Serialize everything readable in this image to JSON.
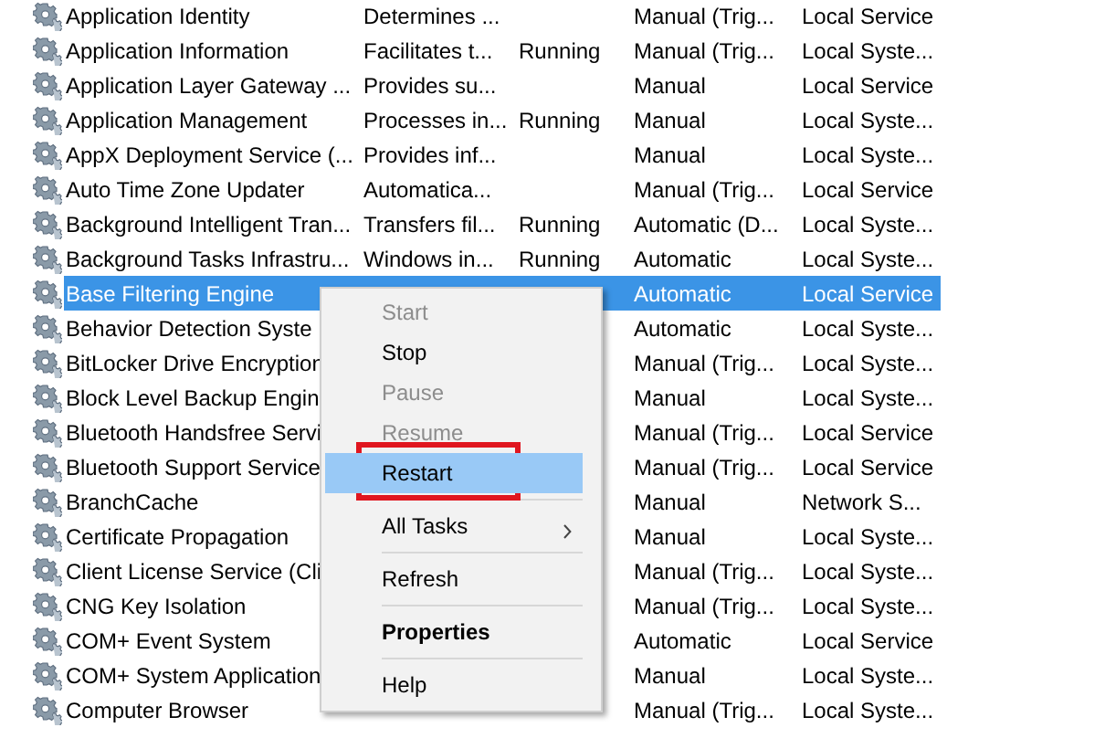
{
  "services": {
    "rows": [
      {
        "name": "Application Identity",
        "description": "Determines ...",
        "status": "",
        "startup": "Manual (Trig...",
        "logon": "Local Service",
        "selected": false
      },
      {
        "name": "Application Information",
        "description": "Facilitates t...",
        "status": "Running",
        "startup": "Manual (Trig...",
        "logon": "Local Syste...",
        "selected": false
      },
      {
        "name": "Application Layer Gateway ...",
        "description": "Provides su...",
        "status": "",
        "startup": "Manual",
        "logon": "Local Service",
        "selected": false
      },
      {
        "name": "Application Management",
        "description": "Processes in...",
        "status": "Running",
        "startup": "Manual",
        "logon": "Local Syste...",
        "selected": false
      },
      {
        "name": "AppX Deployment Service (...",
        "description": "Provides inf...",
        "status": "",
        "startup": "Manual",
        "logon": "Local Syste...",
        "selected": false
      },
      {
        "name": "Auto Time Zone Updater",
        "description": "Automatica...",
        "status": "",
        "startup": "Manual (Trig...",
        "logon": "Local Service",
        "selected": false
      },
      {
        "name": "Background Intelligent Tran...",
        "description": "Transfers fil...",
        "status": "Running",
        "startup": "Automatic (D...",
        "logon": "Local Syste...",
        "selected": false
      },
      {
        "name": "Background Tasks Infrastru...",
        "description": "Windows in...",
        "status": "Running",
        "startup": "Automatic",
        "logon": "Local Syste...",
        "selected": false
      },
      {
        "name": "Base Filtering Engine",
        "description": "",
        "status": "",
        "startup": "Automatic",
        "logon": "Local Service",
        "selected": true
      },
      {
        "name": "Behavior Detection Syste",
        "description": "",
        "status": "",
        "startup": "Automatic",
        "logon": "Local Syste...",
        "selected": false
      },
      {
        "name": "BitLocker Drive Encryption",
        "description": "",
        "status": "",
        "startup": "Manual (Trig...",
        "logon": "Local Syste...",
        "selected": false
      },
      {
        "name": "Block Level Backup Engin",
        "description": "",
        "status": "",
        "startup": "Manual",
        "logon": "Local Syste...",
        "selected": false
      },
      {
        "name": "Bluetooth Handsfree Servi",
        "description": "",
        "status": "",
        "startup": "Manual (Trig...",
        "logon": "Local Service",
        "selected": false
      },
      {
        "name": "Bluetooth Support Service",
        "description": "",
        "status": "",
        "startup": "Manual (Trig...",
        "logon": "Local Service",
        "selected": false
      },
      {
        "name": "BranchCache",
        "description": "",
        "status": "",
        "startup": "Manual",
        "logon": "Network S...",
        "selected": false
      },
      {
        "name": "Certificate Propagation",
        "description": "",
        "status": "",
        "startup": "Manual",
        "logon": "Local Syste...",
        "selected": false
      },
      {
        "name": "Client License Service (Cli",
        "description": "",
        "status": "",
        "startup": "Manual (Trig...",
        "logon": "Local Syste...",
        "selected": false
      },
      {
        "name": "CNG Key Isolation",
        "description": "",
        "status": "",
        "startup": "Manual (Trig...",
        "logon": "Local Syste...",
        "selected": false
      },
      {
        "name": "COM+ Event System",
        "description": "",
        "status": "",
        "startup": "Automatic",
        "logon": "Local Service",
        "selected": false
      },
      {
        "name": "COM+ System Application",
        "description": "",
        "status": "",
        "startup": "Manual",
        "logon": "Local Syste...",
        "selected": false
      },
      {
        "name": "Computer Browser",
        "description": "",
        "status": "",
        "startup": "Manual (Trig...",
        "logon": "Local Syste...",
        "selected": false
      }
    ]
  },
  "context_menu": {
    "items": [
      {
        "kind": "item",
        "label": "Start",
        "disabled": true,
        "selected": false
      },
      {
        "kind": "item",
        "label": "Stop",
        "disabled": false,
        "selected": false
      },
      {
        "kind": "item",
        "label": "Pause",
        "disabled": true,
        "selected": false
      },
      {
        "kind": "item",
        "label": "Resume",
        "disabled": true,
        "selected": false
      },
      {
        "kind": "item",
        "label": "Restart",
        "disabled": false,
        "selected": true,
        "marked": true
      },
      {
        "kind": "separator"
      },
      {
        "kind": "submenu",
        "label": "All Tasks",
        "disabled": false,
        "selected": false
      },
      {
        "kind": "separator"
      },
      {
        "kind": "item",
        "label": "Refresh",
        "disabled": false,
        "selected": false
      },
      {
        "kind": "separator"
      },
      {
        "kind": "item",
        "label": "Properties",
        "disabled": false,
        "selected": false,
        "default": true
      },
      {
        "kind": "separator"
      },
      {
        "kind": "item",
        "label": "Help",
        "disabled": false,
        "selected": false
      }
    ]
  }
}
